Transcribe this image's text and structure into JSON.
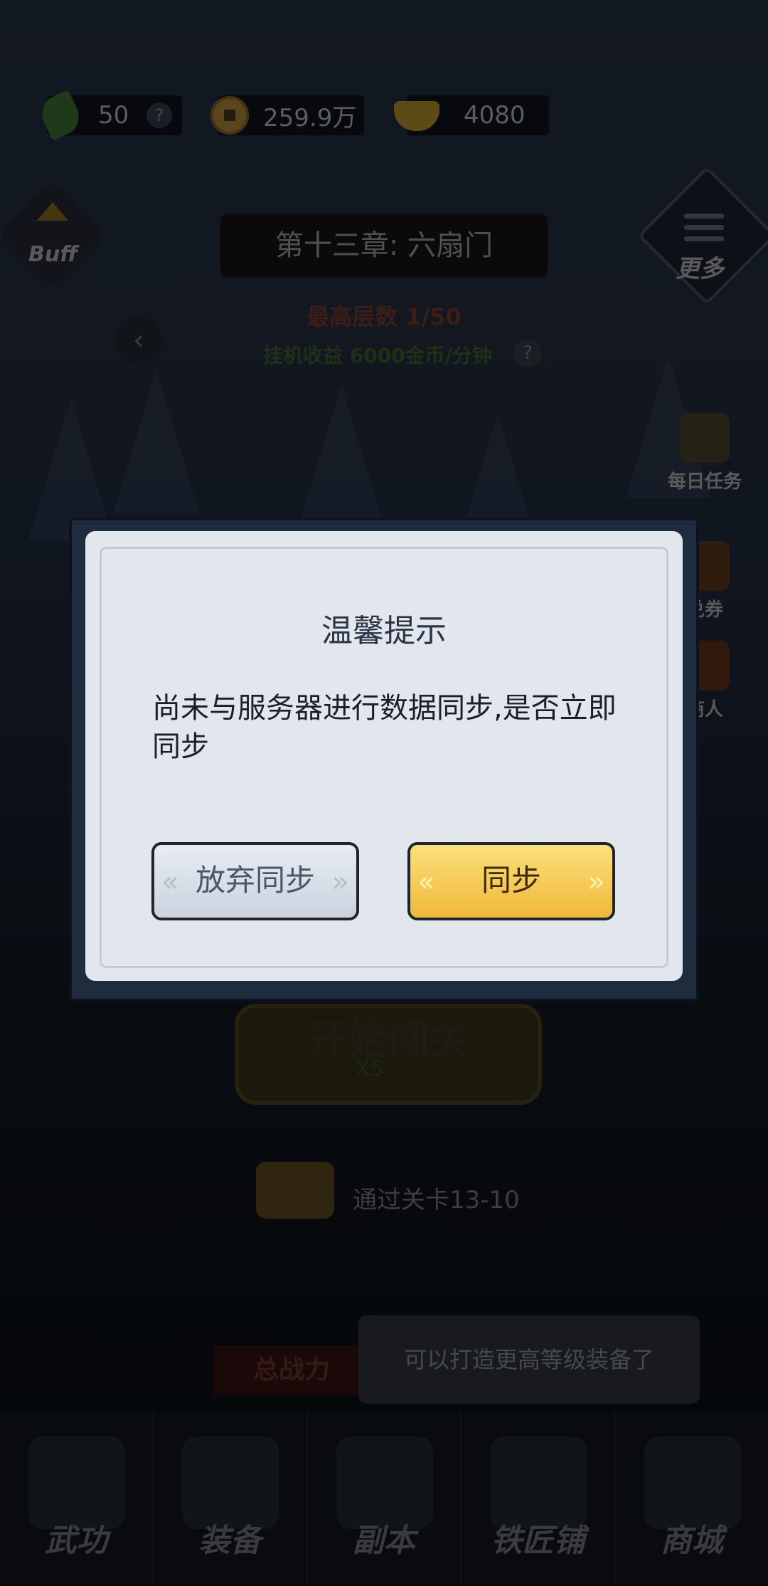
{
  "resources": {
    "stamina": "50",
    "coins": "259.9万",
    "gold": "4080",
    "help": "?"
  },
  "buff_label": "Buff",
  "chapter_title": "第十三章: 六扇门",
  "more_label": "更多",
  "floor": {
    "max_floor": "最高层数 1/50",
    "idle_income": "挂机收益 6000金币/分钟",
    "help": "?",
    "back": "‹"
  },
  "side_menu": {
    "daily_tasks": "每日任务",
    "voucher": "兑券",
    "merchant": "商人"
  },
  "start_button": {
    "label": "开始闯关",
    "cost": "X5"
  },
  "reward_hint": "通过关卡13-10",
  "total_power": "总战力",
  "toast": "可以打造更高等级装备了",
  "bottom_nav": [
    "武功",
    "装备",
    "副本",
    "铁匠铺",
    "商城"
  ],
  "dialog": {
    "title": "温馨提示",
    "message": "尚未与服务器进行数据同步,是否立即同步",
    "cancel_label": "放弃同步",
    "confirm_label": "同步"
  },
  "colors": {
    "confirm_button": "#f0b83a",
    "cancel_button": "#c9d2dd",
    "dialog_frame": "#1f2b3f",
    "dialog_paper": "#e2e7ee"
  }
}
